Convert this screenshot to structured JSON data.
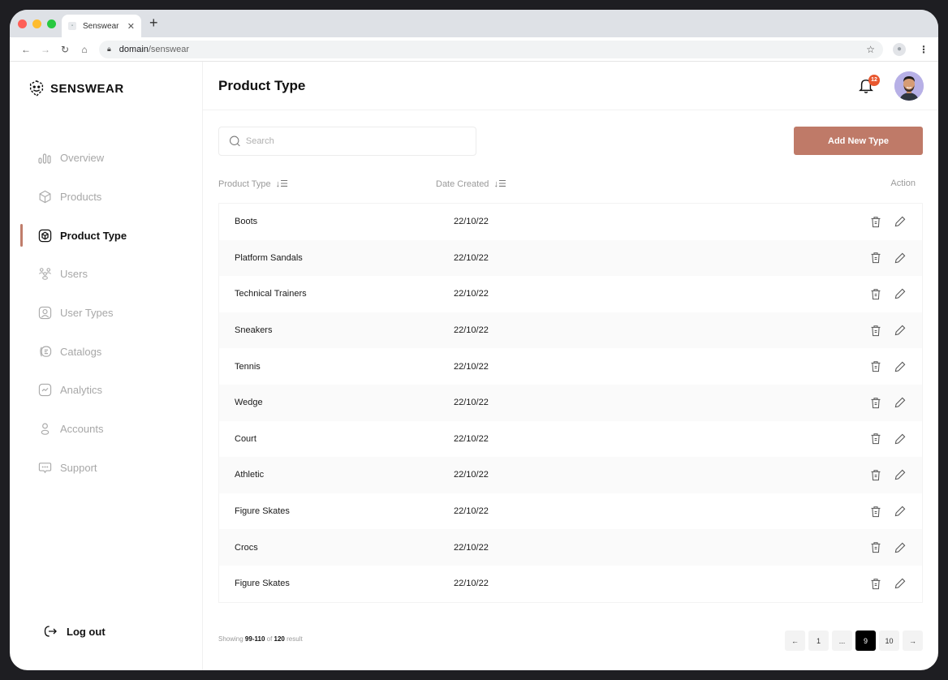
{
  "browser": {
    "tab_title": "Senswear",
    "tab_favicon": "image-icon",
    "url_domain": "domain",
    "url_path": "/senswear"
  },
  "brand": {
    "name": "SENSWEAR",
    "accent": "#bf7a68"
  },
  "sidebar": {
    "items": [
      {
        "label": "Overview",
        "icon": "bar-chart-icon",
        "active": false
      },
      {
        "label": "Products",
        "icon": "box-icon",
        "active": false
      },
      {
        "label": "Product Type",
        "icon": "cube-icon",
        "active": true
      },
      {
        "label": "Users",
        "icon": "users-icon",
        "active": false
      },
      {
        "label": "User Types",
        "icon": "user-square-icon",
        "active": false
      },
      {
        "label": "Catalogs",
        "icon": "catalog-icon",
        "active": false
      },
      {
        "label": "Analytics",
        "icon": "analytics-icon",
        "active": false
      },
      {
        "label": "Accounts",
        "icon": "user-icon",
        "active": false
      },
      {
        "label": "Support",
        "icon": "chat-icon",
        "active": false
      }
    ],
    "logout_label": "Log out"
  },
  "header": {
    "title": "Product Type",
    "notification_count": "12"
  },
  "toolbar": {
    "search_placeholder": "Search",
    "add_button_label": "Add New Type"
  },
  "table": {
    "columns": {
      "type": "Product Type",
      "date": "Date Created",
      "action": "Action"
    },
    "rows": [
      {
        "name": "Boots",
        "date": "22/10/22"
      },
      {
        "name": "Platform Sandals",
        "date": "22/10/22"
      },
      {
        "name": "Technical Trainers",
        "date": "22/10/22"
      },
      {
        "name": "Sneakers",
        "date": "22/10/22"
      },
      {
        "name": "Tennis",
        "date": "22/10/22"
      },
      {
        "name": "Wedge",
        "date": "22/10/22"
      },
      {
        "name": "Court",
        "date": "22/10/22"
      },
      {
        "name": "Athletic",
        "date": "22/10/22"
      },
      {
        "name": "Figure Skates",
        "date": "22/10/22"
      },
      {
        "name": "Crocs",
        "date": "22/10/22"
      },
      {
        "name": "Figure Skates",
        "date": "22/10/22"
      }
    ]
  },
  "footer": {
    "showing_prefix": "Showing",
    "range": "99-110",
    "of_label": "of",
    "total": "120",
    "suffix": "result"
  },
  "pagination": {
    "prev": "←",
    "pages": [
      "1",
      "...",
      "9",
      "10"
    ],
    "current": "9",
    "next": "→"
  }
}
